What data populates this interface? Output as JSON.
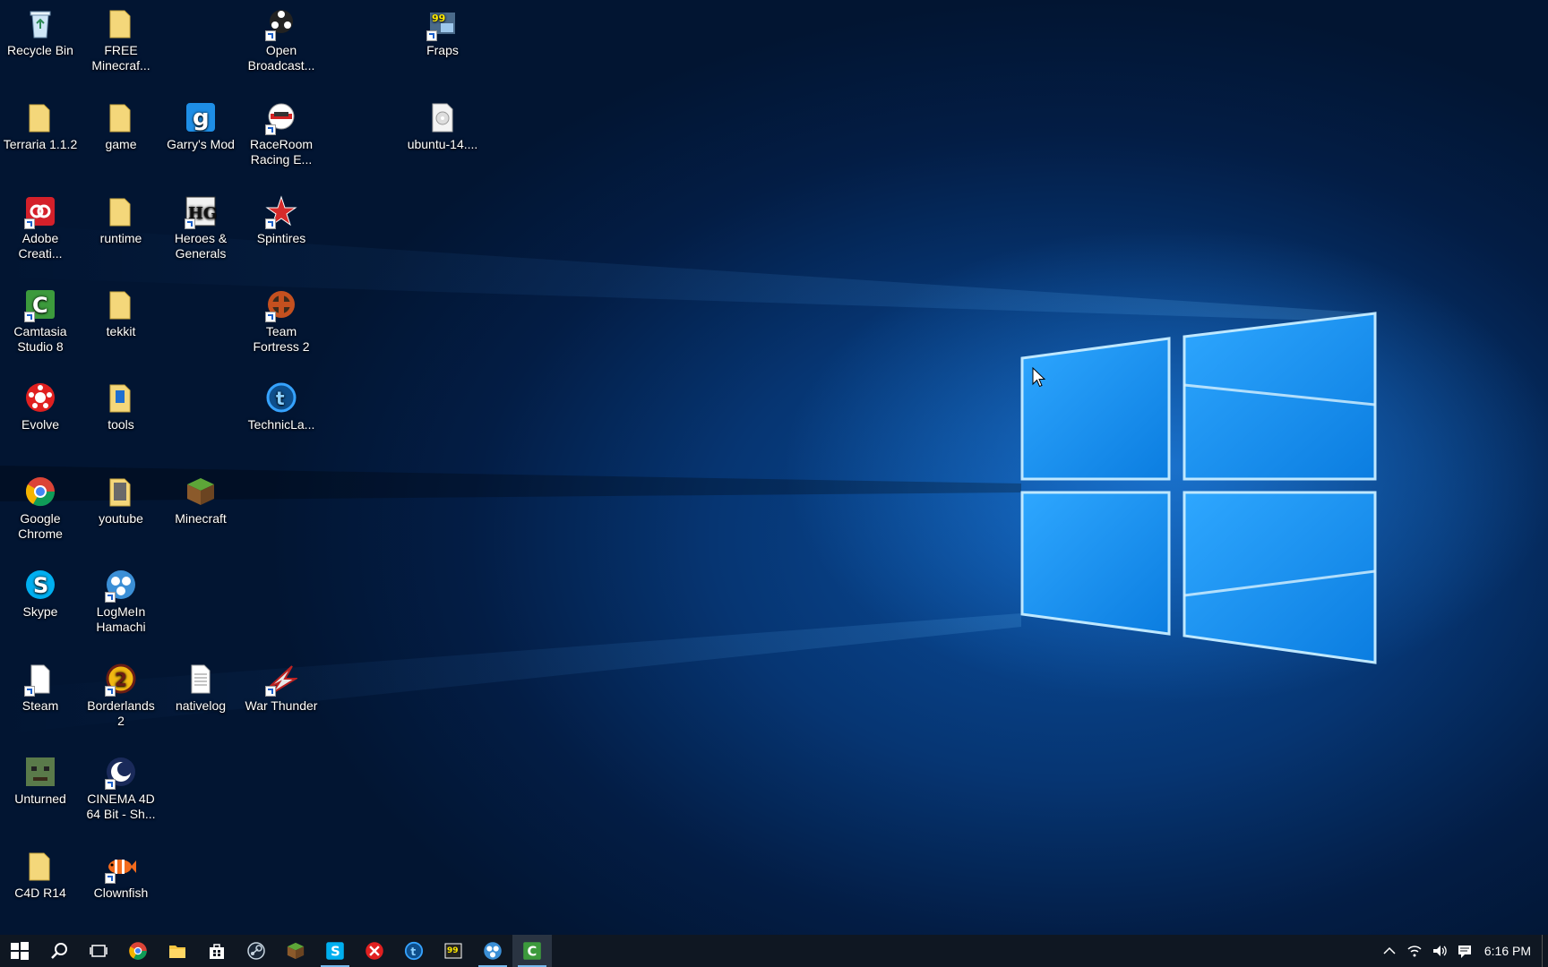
{
  "desktop": {
    "icons": [
      {
        "label": "Recycle Bin",
        "icon": "recycle-bin-icon"
      },
      {
        "label": "FREE Minecraf...",
        "icon": "folder-icon"
      },
      {
        "label": "Open Broadcast...",
        "icon": "obs-icon"
      },
      {
        "label": "Fraps",
        "icon": "fraps-icon"
      },
      {
        "label": "Terraria 1.1.2",
        "icon": "folder-icon"
      },
      {
        "label": "game",
        "icon": "folder-icon"
      },
      {
        "label": "Garry's Mod",
        "icon": "garrys-mod-icon"
      },
      {
        "label": "RaceRoom Racing E...",
        "icon": "raceroom-icon"
      },
      {
        "label": "ubuntu-14....",
        "icon": "disc-image-icon"
      },
      {
        "label": "Adobe Creati...",
        "icon": "adobe-cc-icon"
      },
      {
        "label": "runtime",
        "icon": "folder-icon"
      },
      {
        "label": "Heroes & Generals",
        "icon": "heroes-generals-icon"
      },
      {
        "label": "Spintires",
        "icon": "spintires-icon"
      },
      {
        "label": "Camtasia Studio 8",
        "icon": "camtasia-icon"
      },
      {
        "label": "tekkit",
        "icon": "folder-icon"
      },
      {
        "label": "Team Fortress 2",
        "icon": "tf2-icon"
      },
      {
        "label": "Evolve",
        "icon": "evolve-icon"
      },
      {
        "label": "tools",
        "icon": "folder-icon"
      },
      {
        "label": "TechnicLa...",
        "icon": "technic-launcher-icon"
      },
      {
        "label": "Google Chrome",
        "icon": "chrome-icon"
      },
      {
        "label": "youtube",
        "icon": "folder-icon"
      },
      {
        "label": "Minecraft",
        "icon": "minecraft-icon"
      },
      {
        "label": "Skype",
        "icon": "skype-icon"
      },
      {
        "label": "LogMeIn Hamachi",
        "icon": "hamachi-icon"
      },
      {
        "label": "Steam",
        "icon": "file-icon"
      },
      {
        "label": "Borderlands 2",
        "icon": "borderlands-icon"
      },
      {
        "label": "nativelog",
        "icon": "text-file-icon"
      },
      {
        "label": "War Thunder",
        "icon": "war-thunder-icon"
      },
      {
        "label": "Unturned",
        "icon": "unturned-icon"
      },
      {
        "label": "CINEMA 4D 64 Bit - Sh...",
        "icon": "cinema4d-icon"
      },
      {
        "label": "C4D R14",
        "icon": "folder-icon"
      },
      {
        "label": "Clownfish",
        "icon": "clownfish-icon"
      }
    ]
  },
  "taskbar": {
    "buttons": [
      {
        "icon": "windows-start-icon"
      },
      {
        "icon": "search-icon"
      },
      {
        "icon": "task-view-icon"
      },
      {
        "icon": "chrome-icon"
      },
      {
        "icon": "file-explorer-icon"
      },
      {
        "icon": "store-icon"
      },
      {
        "icon": "steam-icon"
      },
      {
        "icon": "minecraft-icon"
      },
      {
        "icon": "skype-icon"
      },
      {
        "icon": "evolve-icon"
      },
      {
        "icon": "technic-launcher-icon"
      },
      {
        "icon": "fraps-icon"
      },
      {
        "icon": "hamachi-icon"
      },
      {
        "icon": "camtasia-icon"
      }
    ],
    "clock": "6:16 PM"
  },
  "colors": {
    "taskbar": "#0f1722",
    "accent": "#76b9ed",
    "folder": "#f4d77a"
  }
}
